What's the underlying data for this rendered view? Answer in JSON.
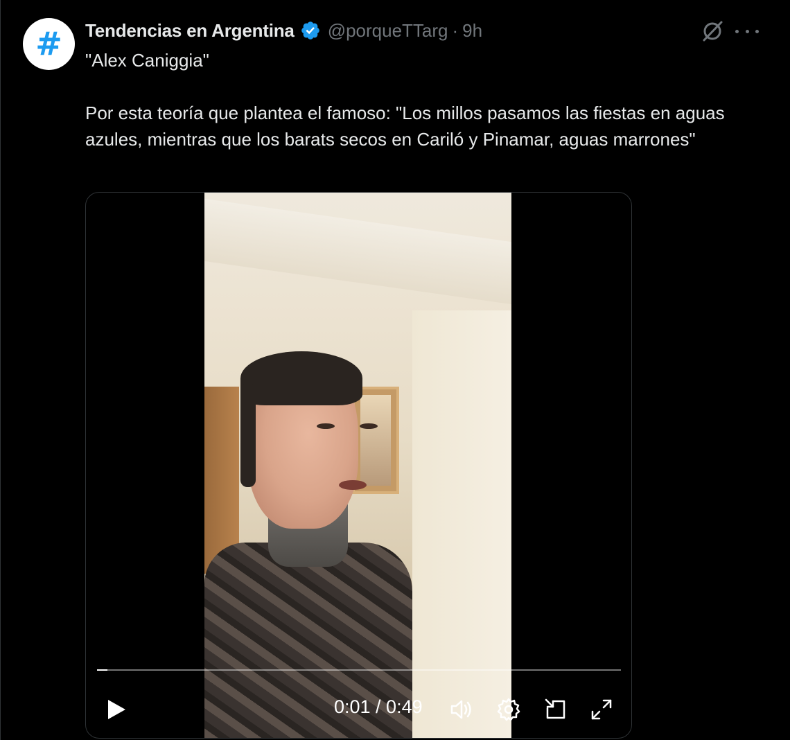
{
  "author": {
    "display_name": "Tendencias en Argentina",
    "handle": "@porqueTTarg",
    "separator": "·",
    "time": "9h",
    "avatar_glyph": "#",
    "verified": true
  },
  "tweet": {
    "line1": "\"Alex Caniggia\"",
    "line2": "Por esta teoría que plantea el famoso: \"Los millos pasamos las fiestas en aguas azules, mientras que los barats secos en Cariló y Pinamar, aguas marrones\""
  },
  "video": {
    "time_display": "0:01 / 0:49",
    "progress_fraction": 0.02
  },
  "icons": {
    "grok": "grok-icon",
    "more": "more-icon",
    "play": "play-icon",
    "volume": "volume-icon",
    "settings": "gear-icon",
    "pip": "picture-in-picture-icon",
    "fullscreen": "fullscreen-icon"
  },
  "colors": {
    "background": "#000000",
    "text": "#e7e9ea",
    "muted": "#71767b",
    "accent": "#1d9bf0"
  }
}
